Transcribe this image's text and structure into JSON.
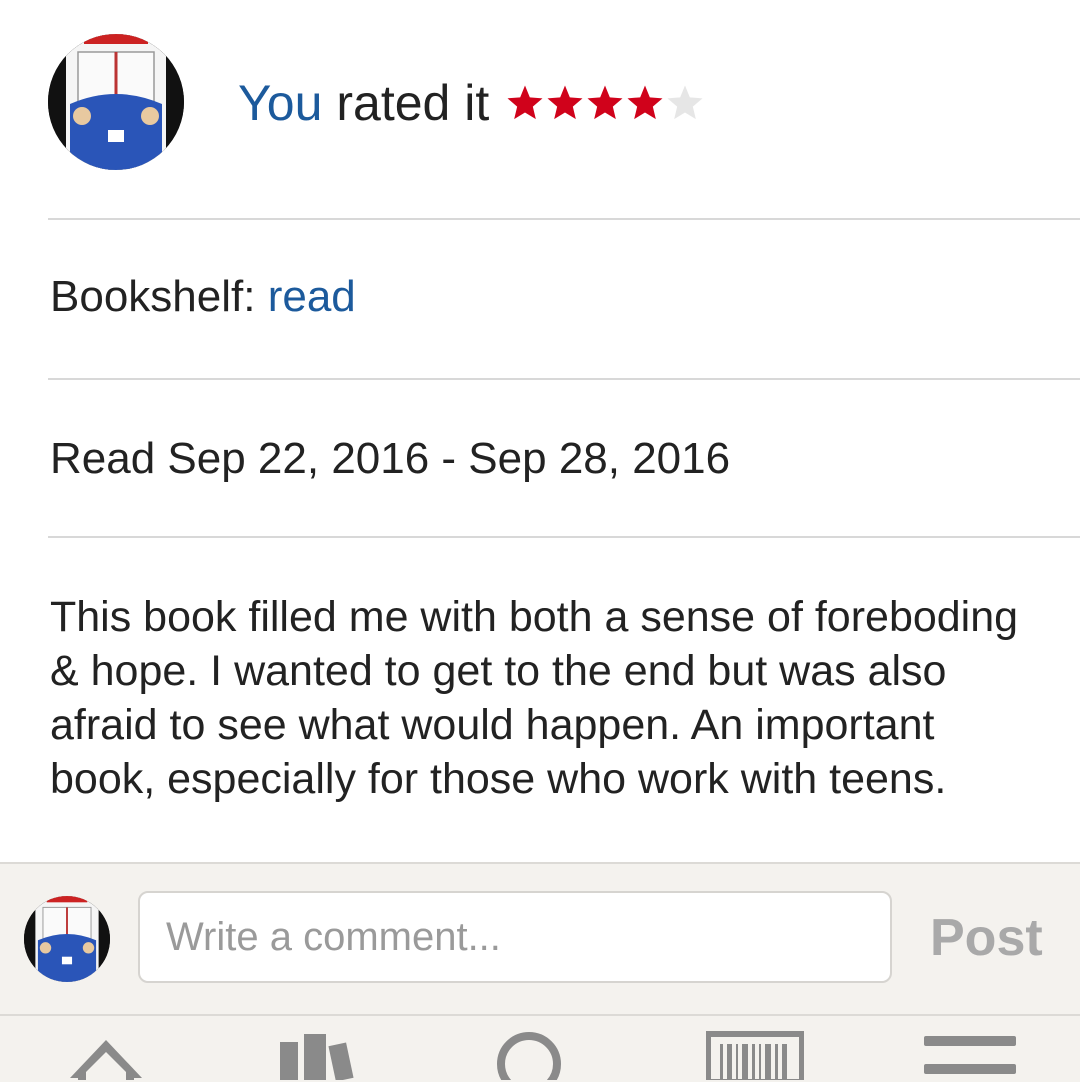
{
  "header": {
    "you": "You",
    "rated": "rated it",
    "rating": 4,
    "max_rating": 5,
    "star_color": "#d0021b",
    "empty_star_color": "#e6e6e6"
  },
  "bookshelf": {
    "label": "Bookshelf:",
    "value": "read"
  },
  "read_dates": "Read Sep 22, 2016 - Sep 28, 2016",
  "review": "This book filled me with both a sense of foreboding & hope. I wanted to get to the end but was also afraid to see what would happen. An important book, especially for those who work with teens.",
  "comment": {
    "placeholder": "Write a comment...",
    "post_label": "Post"
  },
  "tabbar": {
    "icons": [
      "home-icon",
      "books-icon",
      "search-icon",
      "barcode-scan-icon",
      "menu-icon"
    ]
  },
  "colors": {
    "link_blue": "#1c5a9c",
    "text": "#222222",
    "divider": "#d8d8d8",
    "footer_bg": "#f4f2ee"
  }
}
